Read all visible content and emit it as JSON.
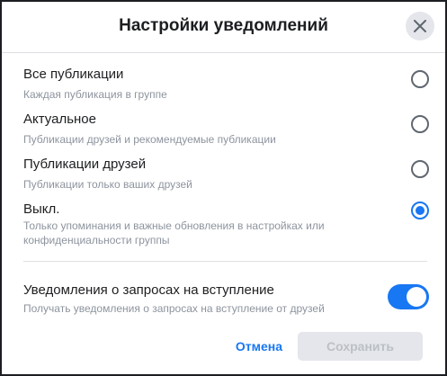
{
  "dialog": {
    "title": "Настройки уведомлений",
    "close_icon": "close-icon"
  },
  "options": [
    {
      "label": "Все публикации",
      "description": "Каждая публикация в группе",
      "checked": false
    },
    {
      "label": "Актуальное",
      "description": "Публикации друзей и рекомендуемые публикации",
      "checked": false
    },
    {
      "label": "Публикации друзей",
      "description": "Публикации только ваших друзей",
      "checked": false
    },
    {
      "label": "Выкл.",
      "description": "Только упоминания и важные обновления в настройках или конфиденциальности группы",
      "checked": true
    }
  ],
  "join_requests": {
    "label": "Уведомления о запросах на вступление",
    "description": "Получать уведомления о запросах на вступление от друзей",
    "enabled": true
  },
  "buttons": {
    "cancel_label": "Отмена",
    "save_label": "Сохранить"
  },
  "colors": {
    "accent": "#1877f2",
    "disabled_button_bg": "#e4e6eb",
    "disabled_button_text": "#bcc0c4"
  }
}
